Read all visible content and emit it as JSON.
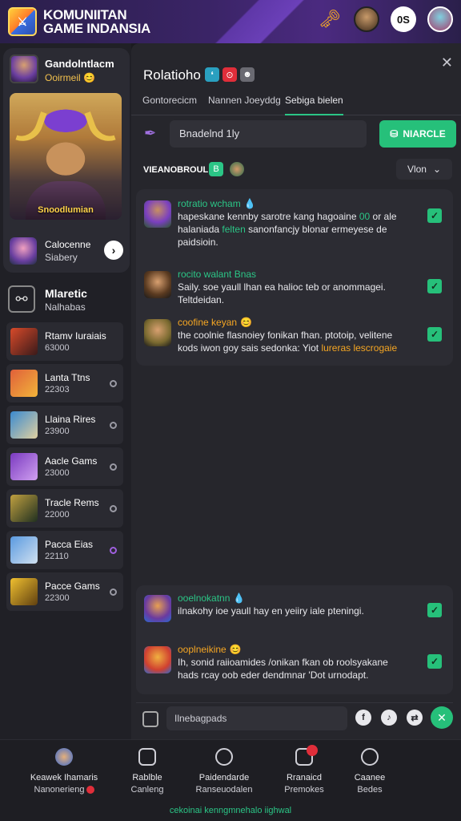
{
  "header": {
    "brand_line1": "KOMUNIITAN",
    "brand_line2": "GAME INDANSIA",
    "pill": "0S"
  },
  "sidebar": {
    "profile": {
      "name": "Gandolntlacm",
      "status": "Ooirmeil 😊"
    },
    "hero_caption": "Snoodlumian",
    "friend": {
      "name": "Calocenne",
      "sub": "Siabery"
    },
    "section": {
      "title": "Mlaretic",
      "sub": "Nalhabas"
    },
    "games": [
      {
        "name": "Rtamv Iuraiais",
        "count": "63000",
        "color1": "#d84a2a",
        "color2": "#3a1a1a"
      },
      {
        "name": "Lanta Ttns",
        "count": "22303",
        "color1": "#e0603a",
        "color2": "#f2b43a"
      },
      {
        "name": "Llaina Rires",
        "count": "23900",
        "color1": "#3a8ad0",
        "color2": "#e0d0a0"
      },
      {
        "name": "Aacle Gams",
        "count": "23000",
        "color1": "#7a3ac0",
        "color2": "#d0a0f0"
      },
      {
        "name": "Tracle Rems",
        "count": "22000",
        "color1": "#c0a040",
        "color2": "#203020"
      },
      {
        "name": "Pacca Eias",
        "count": "22110",
        "color1": "#5a9ae0",
        "color2": "#d0e0f0"
      },
      {
        "name": "Pacce Gams",
        "count": "22300",
        "color1": "#f0c030",
        "color2": "#604010"
      }
    ]
  },
  "panel": {
    "room_title": "Rolatioho",
    "tabs": [
      "Gontorecicm",
      "Nannen Joeyddg",
      "Sebiga bielen"
    ],
    "composer_value": "Bnadelnd 1ly",
    "composer_button": "NIARCLE",
    "filter_label": "VIEANOBROUL",
    "filter_badge": "B",
    "select_value": "Vlon",
    "messages_top": [
      {
        "author": "rotratio wcham",
        "author_color": "#2bc586",
        "emoji": "💧",
        "text": "hapeskane kennby sarotre kang hagoaine ",
        "highlight": "00",
        "highlight_color": "#2bc586",
        "text2": " or ale halaniada ",
        "hl2": "felten",
        "hl2_color": "#2bc586",
        "text3": " sanonfancjy blonar ermeyese de paidsioin."
      },
      {
        "author": "rocito walant Bnas",
        "author_color": "#2bc586",
        "emoji": "",
        "text": " Saily. soe yaull lhan ea halioc teb or anommagei. Teltdeidan.",
        "highlight": "",
        "highlight_color": "",
        "text2": "",
        "hl2": "",
        "hl2_color": "",
        "text3": ""
      },
      {
        "author": "coofine keyan",
        "author_color": "#f5a623",
        "emoji": "😊",
        "text": " the coolnie flasnoiey fonikan fhan. ptotoip, velitene kods iwon goy sais sedonka: Yiot ",
        "highlight": "",
        "highlight_color": "",
        "text2": "",
        "hl2": "lureras lescrogaie",
        "hl2_color": "#f5a623",
        "text3": ""
      }
    ],
    "messages_bottom": [
      {
        "author": "ooelnokatnn",
        "author_color": "#2bc586",
        "emoji": "💧",
        "text": " ilnakohy ioe yaull hay en yeiiry iale pteningi."
      },
      {
        "author": "ooplneikine",
        "author_color": "#f5a623",
        "emoji": "😊",
        "text": " Ih, sonid raiioamides /onikan fkan ob roolsyakane hads rcay oob eder dendmnar 'Dot urnodapt."
      }
    ],
    "bottom_placeholder": "Ilnebagpads"
  },
  "bottom_nav": [
    {
      "l1": "Keawek Ihamaris",
      "l2": "Nanonerieng"
    },
    {
      "l1": "Rablble",
      "l2": "Canleng"
    },
    {
      "l1": "Paidendarde",
      "l2": "Ranseuodalen"
    },
    {
      "l1": "Rranaicd",
      "l2": "Premokes"
    },
    {
      "l1": "Caanee",
      "l2": "Bedes"
    }
  ],
  "footer_link": "cekoinai kenngmnehalo iighwal",
  "colors": {
    "accent": "#26c07a",
    "panel": "#26262c",
    "brand_purple": "#4b2a80"
  }
}
